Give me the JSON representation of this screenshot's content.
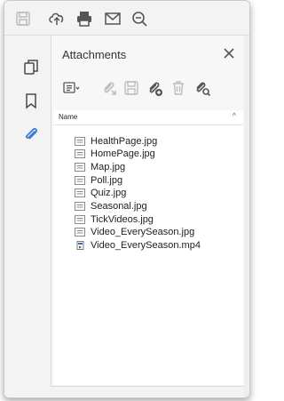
{
  "panel": {
    "title": "Attachments"
  },
  "list": {
    "column_name": "Name",
    "sort_indicator": "^",
    "items": [
      {
        "name": "HealthPage.jpg",
        "type": "image"
      },
      {
        "name": "HomePage.jpg",
        "type": "image"
      },
      {
        "name": "Map.jpg",
        "type": "image"
      },
      {
        "name": "Poll.jpg",
        "type": "image"
      },
      {
        "name": "Quiz.jpg",
        "type": "image"
      },
      {
        "name": "Seasonal.jpg",
        "type": "image"
      },
      {
        "name": "TickVideos.jpg",
        "type": "image"
      },
      {
        "name": "Video_EverySeason.jpg",
        "type": "image"
      },
      {
        "name": "Video_EverySeason.mp4",
        "type": "video"
      }
    ]
  },
  "colors": {
    "accent": "#3b7bd8",
    "disabled": "#bdbdbd"
  }
}
